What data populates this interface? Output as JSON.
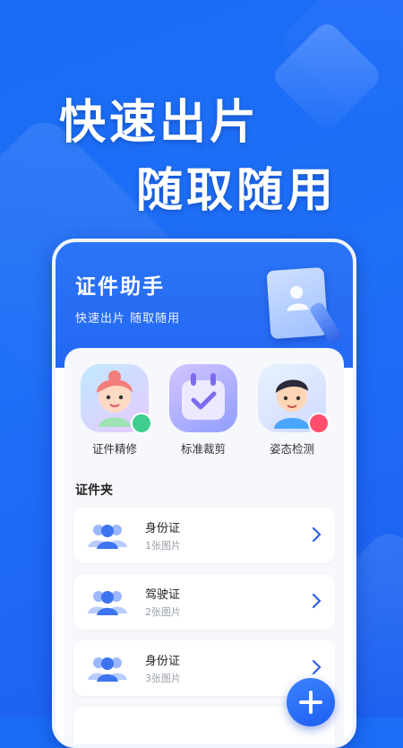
{
  "promo": {
    "headline_line1": "快速出片",
    "headline_line2": "随取随用"
  },
  "app": {
    "title": "证件助手",
    "subtitle": "快速出片 随取随用"
  },
  "features": [
    {
      "label": "证件精修",
      "icon": "woman-avatar-icon"
    },
    {
      "label": "标准裁剪",
      "icon": "calendar-check-icon"
    },
    {
      "label": "姿态检测",
      "icon": "man-avatar-icon"
    }
  ],
  "folder": {
    "title": "证件夹",
    "items": [
      {
        "name": "身份证",
        "count": "1张图片"
      },
      {
        "name": "驾驶证",
        "count": "2张图片"
      },
      {
        "name": "身份证",
        "count": "3张图片"
      }
    ]
  },
  "colors": {
    "accent": "#2468f3",
    "background": "#1a6cf5"
  }
}
